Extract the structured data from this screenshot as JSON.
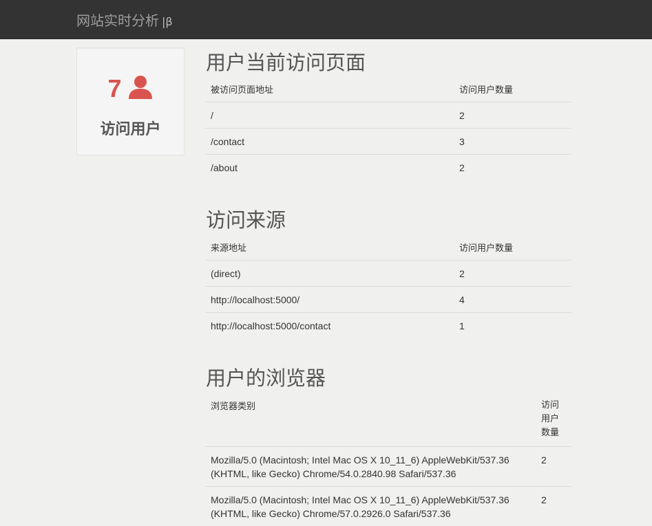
{
  "app": {
    "brand": "网站实时分析",
    "beta": "|β"
  },
  "stats": {
    "active_users_count": "7",
    "active_users_label": "访问用户",
    "icon": "user-icon",
    "count_color": "#d9534f"
  },
  "pages": {
    "title": "用户当前访问页面",
    "headers": [
      "被访问页面地址",
      "访问用户数量"
    ],
    "rows": [
      [
        "/",
        "2"
      ],
      [
        "/contact",
        "3"
      ],
      [
        "/about",
        "2"
      ]
    ]
  },
  "referrers": {
    "title": "访问来源",
    "headers": [
      "来源地址",
      "访问用户数量"
    ],
    "rows": [
      [
        "(direct)",
        "2"
      ],
      [
        "http://localhost:5000/",
        "4"
      ],
      [
        "http://localhost:5000/contact",
        "1"
      ]
    ]
  },
  "browsers": {
    "title": "用户的浏览器",
    "headers": [
      "浏览器类别",
      "访问用户数量"
    ],
    "rows": [
      [
        "Mozilla/5.0 (Macintosh; Intel Mac OS X 10_11_6) AppleWebKit/537.36 (KHTML, like Gecko) Chrome/54.0.2840.98 Safari/537.36",
        "2"
      ],
      [
        "Mozilla/5.0 (Macintosh; Intel Mac OS X 10_11_6) AppleWebKit/537.36 (KHTML, like Gecko) Chrome/57.0.2926.0 Safari/537.36",
        "2"
      ]
    ]
  }
}
